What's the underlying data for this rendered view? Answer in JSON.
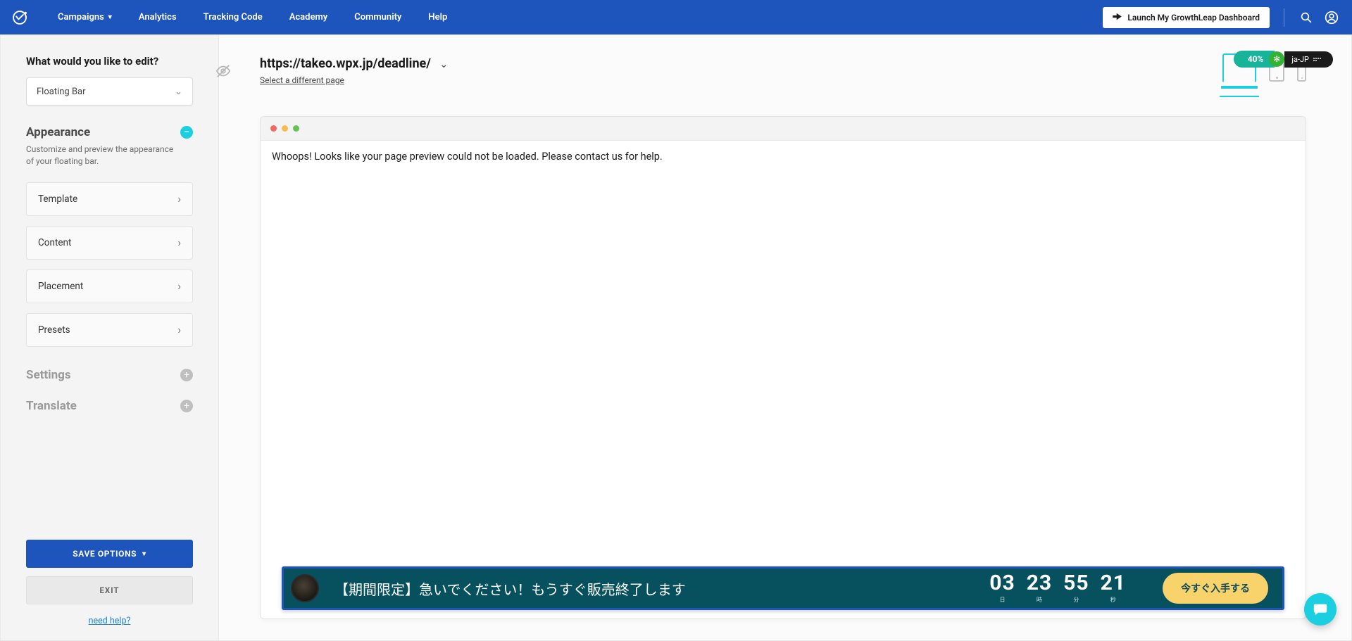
{
  "nav": {
    "items": [
      "Campaigns",
      "Analytics",
      "Tracking Code",
      "Academy",
      "Community",
      "Help"
    ],
    "launch_label": "Launch My GrowthLeap Dashboard"
  },
  "sidebar": {
    "title": "What would you like to edit?",
    "selector_value": "Floating Bar",
    "appearance": {
      "heading": "Appearance",
      "sub": "Customize and preview the appearance of your floating bar.",
      "options": [
        "Template",
        "Content",
        "Placement",
        "Presets"
      ]
    },
    "collapsed": [
      "Settings",
      "Translate"
    ],
    "save_label": "SAVE OPTIONS",
    "exit_label": "EXIT",
    "help_label": "need help?"
  },
  "main": {
    "url": "https://takeo.wpx.jp/deadline/",
    "select_different": "Select a different page",
    "error": "Whoops! Looks like your page preview could not be loaded. Please contact us for help."
  },
  "floating_bar": {
    "message": "【期間限定】急いでください！もうすぐ販売終了します",
    "units": [
      {
        "num": "03",
        "lbl": "日"
      },
      {
        "num": "23",
        "lbl": "時"
      },
      {
        "num": "55",
        "lbl": "分"
      },
      {
        "num": "21",
        "lbl": "秒"
      }
    ],
    "cta": "今すぐ入手する"
  },
  "progress": {
    "percent": "40%",
    "locale": "ja-JP"
  }
}
